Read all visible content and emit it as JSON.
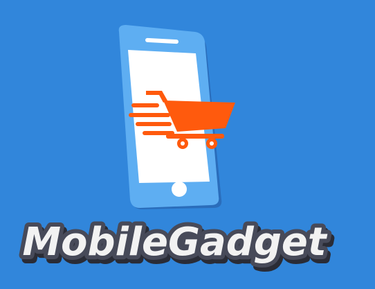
{
  "brand": {
    "name": "MobileGadget"
  },
  "colors": {
    "background": "#3186db",
    "phone_frame": "#5eaef2",
    "phone_frame_shadow": "#1f5fa8",
    "screen": "#ffffff",
    "cart": "#ff5a0d",
    "text_fill": "#f2f2f2",
    "text_outline": "#474a59"
  },
  "icons": {
    "phone": "smartphone-icon",
    "cart": "shopping-cart-icon"
  }
}
